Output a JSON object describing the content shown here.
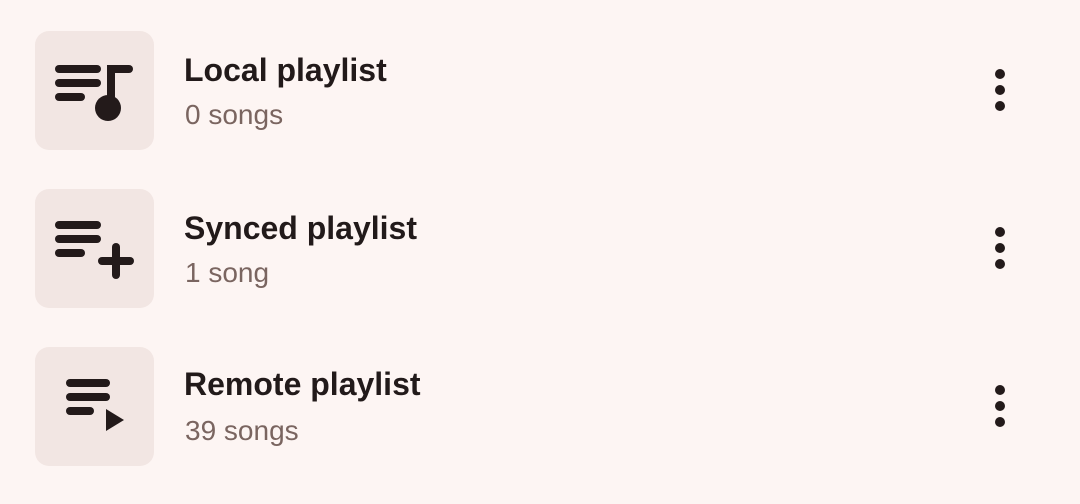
{
  "playlists": [
    {
      "icon": "playlist-music-icon",
      "title": "Local playlist",
      "subtitle": "0 songs"
    },
    {
      "icon": "playlist-add-icon",
      "title": "Synced playlist",
      "subtitle": "1 song"
    },
    {
      "icon": "playlist-play-icon",
      "title": "Remote playlist",
      "subtitle": "39 songs"
    }
  ],
  "more_icon": "more-vert-icon",
  "colors": {
    "background": "#fdf5f3",
    "thumbnail": "#f2e6e3",
    "title": "#221a1a",
    "subtitle": "#7a6560",
    "icon": "#231a1a"
  }
}
